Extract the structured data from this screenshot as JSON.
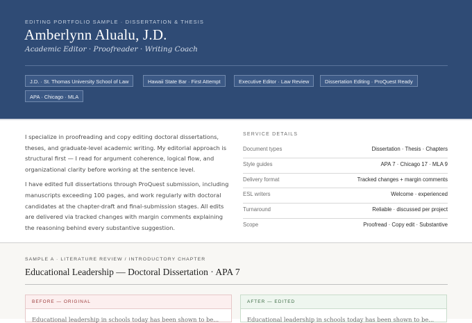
{
  "header": {
    "eyebrow": "EDITING PORTFOLIO SAMPLE · DISSERTATION & THESIS",
    "name": "Amberlynn Alualu, J.D.",
    "tagline": "Academic Editor · Proofreader · Writing Coach",
    "badges": [
      "J.D. · St. Thomas University School of Law",
      "Hawaii State Bar · First Attempt",
      "Executive Editor · Law Review",
      "Dissertation Editing · ProQuest Ready",
      "APA · Chicago · MLA"
    ]
  },
  "intro": {
    "p1": "I specialize in proofreading and copy editing doctoral dissertations, theses, and graduate-level academic writing. My editorial approach is structural first — I read for argument coherence, logical flow, and organizational clarity before working at the sentence level.",
    "p2": "I have edited full dissertations through ProQuest submission, including manuscripts exceeding 100 pages, and work regularly with doctoral candidates at the chapter-draft and final-submission stages. All edits are delivered via tracked changes with margin comments explaining the reasoning behind every substantive suggestion."
  },
  "details": {
    "title": "SERVICE DETAILS",
    "rows": [
      {
        "label": "Document types",
        "value": "Dissertation · Thesis · Chapters"
      },
      {
        "label": "Style guides",
        "value": "APA 7 · Chicago 17 · MLA 9"
      },
      {
        "label": "Delivery format",
        "value": "Tracked changes + margin comments"
      },
      {
        "label": "ESL writers",
        "value": "Welcome · experienced"
      },
      {
        "label": "Turnaround",
        "value": "Reliable · discussed per project"
      },
      {
        "label": "Scope",
        "value": "Proofread · Copy edit · Substantive"
      }
    ]
  },
  "sample": {
    "eyebrow": "SAMPLE A · LITERATURE REVIEW / INTRODUCTORY CHAPTER",
    "title": "Educational Leadership — Doctoral Dissertation · APA 7",
    "before_label": "BEFORE — ORIGINAL",
    "after_label": "AFTER — EDITED",
    "before_text": "Educational leadership in schools today has been shown to be...",
    "after_text": "Educational leadership in schools today has been shown to be..."
  },
  "colors": {
    "hero_bg": "#2f4b75",
    "before_accent": "#9b3a3a",
    "after_accent": "#3c6b44"
  }
}
